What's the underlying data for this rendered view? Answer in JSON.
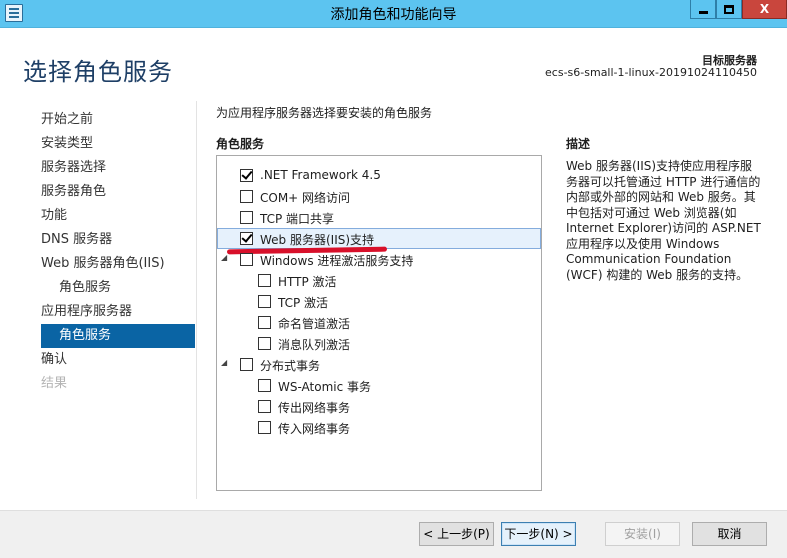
{
  "window": {
    "title": "添加角色和功能向导",
    "min_icon": "minimize-icon",
    "max_icon": "maximize-icon",
    "close_label": "X"
  },
  "header": {
    "page_title": "选择角色服务",
    "target_label": "目标服务器",
    "target_value": "ecs-s6-small-1-linux-20191024110450"
  },
  "sidebar": {
    "items": [
      {
        "label": "开始之前",
        "state": "normal"
      },
      {
        "label": "安装类型",
        "state": "normal"
      },
      {
        "label": "服务器选择",
        "state": "normal"
      },
      {
        "label": "服务器角色",
        "state": "normal"
      },
      {
        "label": "功能",
        "state": "normal"
      },
      {
        "label": "DNS 服务器",
        "state": "normal"
      },
      {
        "label": "Web 服务器角色(IIS)",
        "state": "normal"
      },
      {
        "label": "角色服务",
        "state": "normal"
      },
      {
        "label": "应用程序服务器",
        "state": "normal"
      },
      {
        "label": "角色服务",
        "state": "active"
      },
      {
        "label": "确认",
        "state": "normal"
      },
      {
        "label": "结果",
        "state": "disabled"
      }
    ]
  },
  "main": {
    "instruction": "为应用程序服务器选择要安装的角色服务",
    "roles_header": "角色服务",
    "description_header": "描述",
    "tree": [
      {
        "label": ".NET Framework 4.5",
        "checked": true
      },
      {
        "label": "COM+ 网络访问",
        "checked": false
      },
      {
        "label": "TCP 端口共享",
        "checked": false
      },
      {
        "label": "Web 服务器(IIS)支持",
        "checked": true,
        "selected": true
      },
      {
        "label": "Windows 进程激活服务支持",
        "checked": false,
        "expander": "◢"
      },
      {
        "label": "HTTP 激活",
        "checked": false
      },
      {
        "label": "TCP 激活",
        "checked": false
      },
      {
        "label": "命名管道激活",
        "checked": false
      },
      {
        "label": "消息队列激活",
        "checked": false
      },
      {
        "label": "分布式事务",
        "checked": false,
        "expander": "◢"
      },
      {
        "label": "WS-Atomic 事务",
        "checked": false
      },
      {
        "label": "传出网络事务",
        "checked": false
      },
      {
        "label": "传入网络事务",
        "checked": false
      }
    ],
    "description": "Web 服务器(IIS)支持使应用程序服务器可以托管通过 HTTP 进行通信的内部或外部的网站和 Web 服务。其中包括对可通过 Web 浏览器(如 Internet Explorer)访问的 ASP.NET 应用程序以及使用 Windows Communication Foundation (WCF) 构建的 Web 服务的支持。"
  },
  "footer": {
    "prev_label": "< 上一步(P)",
    "next_label": "下一步(N) >",
    "install_label": "安装(I)",
    "cancel_label": "取消"
  }
}
